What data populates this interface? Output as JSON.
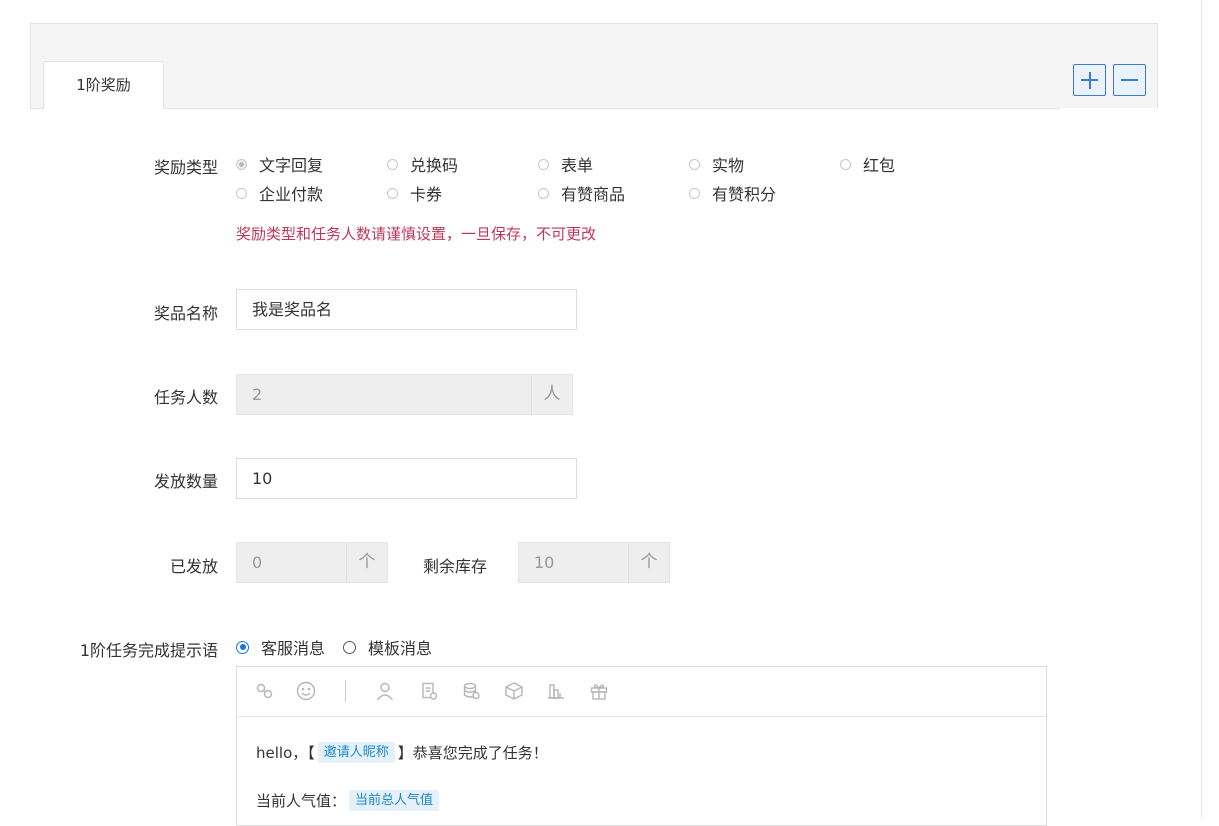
{
  "tabs": {
    "active_label": "1阶奖励",
    "add_icon": "plus-icon",
    "remove_icon": "minus-icon"
  },
  "reward_type": {
    "label": "奖励类型",
    "options": [
      "文字回复",
      "兑换码",
      "表单",
      "实物",
      "红包",
      "企业付款",
      "卡券",
      "有赞商品",
      "有赞积分"
    ],
    "selected": "文字回复",
    "warning": "奖励类型和任务人数请谨慎设置，一旦保存，不可更改"
  },
  "prize_name": {
    "label": "奖品名称",
    "value": "我是奖品名"
  },
  "task_count": {
    "label": "任务人数",
    "value": "2",
    "unit": "人"
  },
  "issue_quantity": {
    "label": "发放数量",
    "value": "10"
  },
  "issued": {
    "label": "已发放",
    "value": "0",
    "unit": "个"
  },
  "remaining": {
    "label": "剩余库存",
    "value": "10",
    "unit": "个"
  },
  "completion_message": {
    "label": "1阶任务完成提示语",
    "options": [
      "客服消息",
      "模板消息"
    ],
    "selected": "客服消息"
  },
  "editor": {
    "toolbar_icons": [
      "link-icon",
      "emoji-icon",
      "user-icon",
      "document-icon",
      "coins-icon",
      "cube-icon",
      "bar-chart-icon",
      "gift-icon"
    ],
    "line1_prefix": "hello，【",
    "line1_tag": "邀请人昵称",
    "line1_suffix": "】恭喜您完成了任务！",
    "line2_prefix": "当前人气值：",
    "line2_tag": "当前总人气值"
  },
  "colors": {
    "accent": "#1a73e8",
    "warning": "#c0375b",
    "tag_bg": "#e4f1fb",
    "tag_text": "#1e88c7"
  }
}
